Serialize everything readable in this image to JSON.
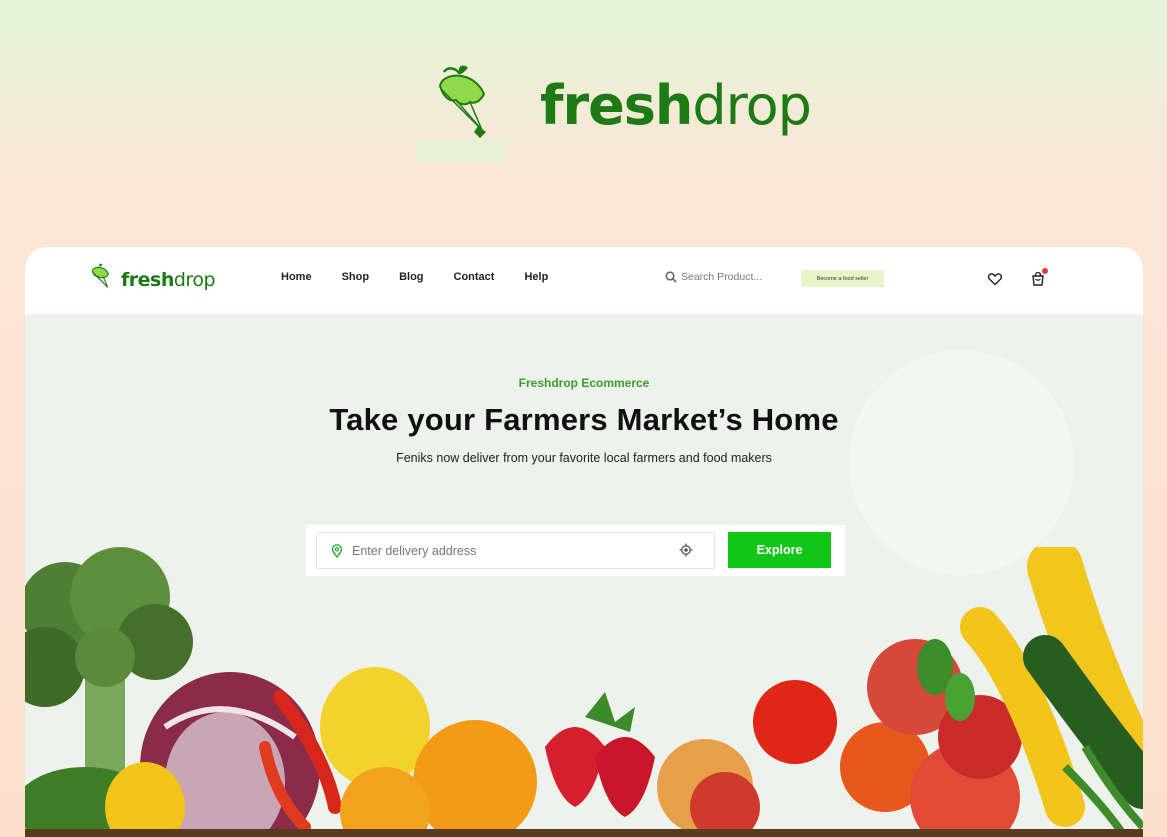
{
  "brand": {
    "name_bold": "fresh",
    "name_light": "drop"
  },
  "nav": {
    "logo_bold": "fresh",
    "logo_light": "drop",
    "menu": [
      {
        "label": "Home"
      },
      {
        "label": "Shop"
      },
      {
        "label": "Blog"
      },
      {
        "label": "Contact"
      },
      {
        "label": "Help"
      }
    ],
    "search_placeholder": "Search Product...",
    "seller_button": "Become a food seller",
    "icons": [
      "search-icon",
      "heart-icon",
      "cart-icon"
    ]
  },
  "hero": {
    "eyebrow": "Freshdrop Ecommerce",
    "headline": "Take your Farmers Market’s Home",
    "subline": "Feniks now deliver from your favorite local farmers and food makers",
    "address_placeholder": "Enter delivery address",
    "explore_button": "Explore",
    "icons": [
      "location-pin-icon",
      "locate-target-icon"
    ]
  },
  "colors": {
    "brand_green": "#1d7a14",
    "accent_green": "#12c617",
    "eyebrow_green": "#3f9a2e",
    "badge_bg": "#e8f5c9",
    "cart_badge": "#e53935"
  }
}
